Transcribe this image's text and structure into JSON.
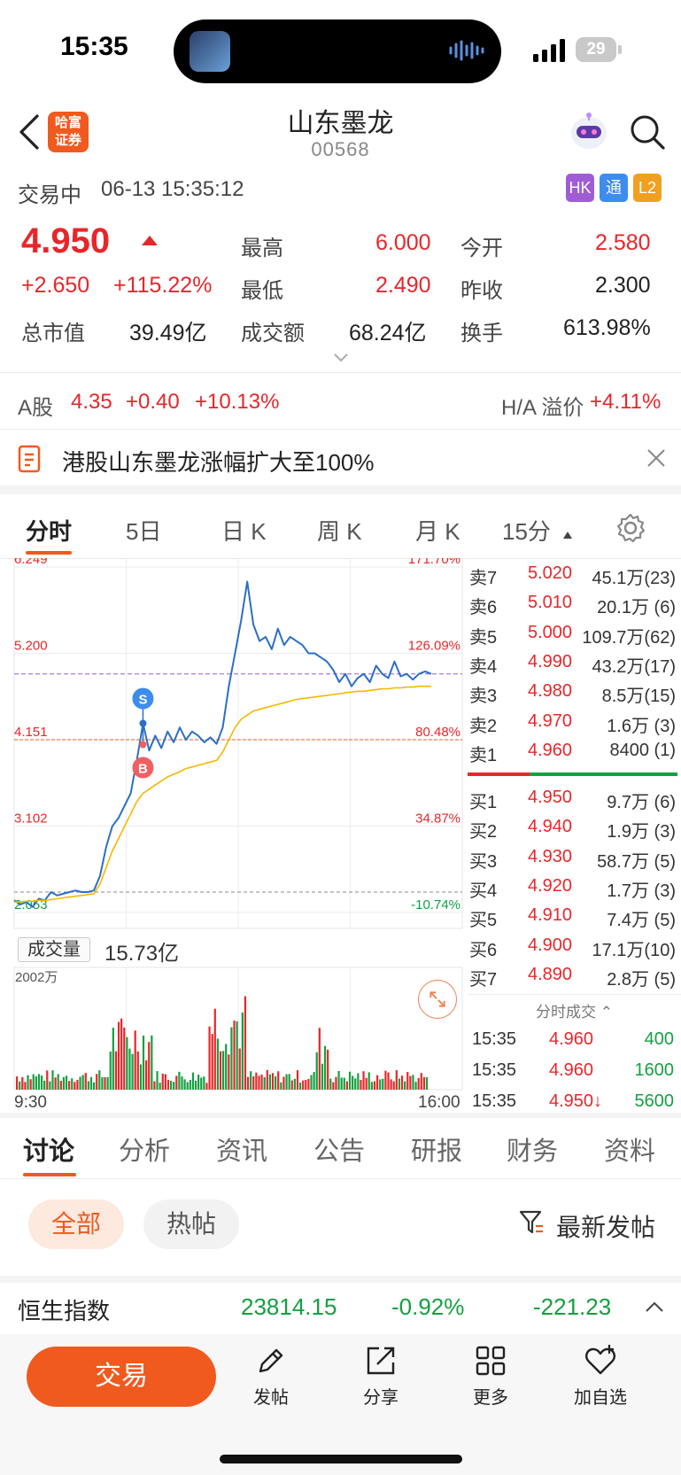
{
  "status_bar": {
    "time": "15:35",
    "battery": "29"
  },
  "header": {
    "logo_line1": "哈富",
    "logo_line2": "证券",
    "title": "山东墨龙",
    "code": "00568"
  },
  "trade_info": {
    "status": "交易中",
    "datetime": "06-13 15:35:12",
    "tags": [
      {
        "label": "HK",
        "color": "#a05cd6"
      },
      {
        "label": "通",
        "color": "#3d8cf0"
      },
      {
        "label": "L2",
        "color": "#f0a020"
      }
    ]
  },
  "quote": {
    "price": "4.950",
    "change": "+2.650",
    "change_pct": "+115.22%",
    "high_label": "最高",
    "high": "6.000",
    "low_label": "最低",
    "low": "2.490",
    "open_label": "今开",
    "open": "2.580",
    "prev_close_label": "昨收",
    "prev_close": "2.300",
    "mktcap_label": "总市值",
    "mktcap": "39.49亿",
    "turnover_label": "成交额",
    "turnover": "68.24亿",
    "turnover_rate_label": "换手",
    "turnover_rate": "613.98%"
  },
  "a_share": {
    "label": "A股",
    "price": "4.35",
    "change": "+0.40",
    "change_pct": "+10.13%",
    "premium_label": "H/A 溢价",
    "premium": "+4.11%"
  },
  "notice": {
    "text": "港股山东墨龙涨幅扩大至100%"
  },
  "chart_tabs": [
    "分时",
    "5日",
    "日 K",
    "周 K",
    "月 K",
    "15分"
  ],
  "chart_data": {
    "type": "line",
    "title": "",
    "x_start_label": "9:30",
    "x_end_label": "16:00",
    "price_axis": [
      "6.249",
      "5.200",
      "4.151",
      "3.102",
      "2.053"
    ],
    "pct_axis": [
      "171.70%",
      "126.09%",
      "80.48%",
      "34.87%",
      "-10.74%"
    ],
    "ylim": [
      2.053,
      6.249
    ],
    "prev_close": 2.3,
    "current_price": 4.95,
    "series": [
      {
        "color": "#2b6fc6",
        "values": [
          2.2,
          2.15,
          2.18,
          2.12,
          2.22,
          2.2,
          2.3,
          2.26,
          2.28,
          2.3,
          2.32,
          2.3,
          2.3,
          2.32,
          2.5,
          2.85,
          3.1,
          3.2,
          3.35,
          3.5,
          3.9,
          4.35,
          4.02,
          4.2,
          4.05,
          4.25,
          4.12,
          4.3,
          4.15,
          4.25,
          4.2,
          4.12,
          4.18,
          4.1,
          4.3,
          4.8,
          5.2,
          5.6,
          6.07,
          5.55,
          5.35,
          5.4,
          5.25,
          5.5,
          5.3,
          5.4,
          5.35,
          5.3,
          5.2,
          5.2,
          5.15,
          5.1,
          5.0,
          4.85,
          4.95,
          4.8,
          4.9,
          4.95,
          4.85,
          5.05,
          4.95,
          4.9,
          5.1,
          4.92,
          4.95,
          4.88,
          4.95,
          4.98,
          4.95
        ],
        "marks": [
          {
            "type": "S",
            "index": 21
          },
          {
            "type": "B",
            "index": 21
          }
        ]
      },
      {
        "color": "#f5b800",
        "values": [
          2.18,
          2.18,
          2.19,
          2.19,
          2.2,
          2.2,
          2.21,
          2.22,
          2.23,
          2.24,
          2.25,
          2.26,
          2.27,
          2.28,
          2.4,
          2.6,
          2.8,
          2.95,
          3.1,
          3.25,
          3.4,
          3.5,
          3.55,
          3.6,
          3.65,
          3.7,
          3.73,
          3.76,
          3.8,
          3.82,
          3.84,
          3.86,
          3.88,
          3.9,
          4.0,
          4.15,
          4.3,
          4.4,
          4.45,
          4.5,
          4.52,
          4.54,
          4.56,
          4.58,
          4.6,
          4.62,
          4.64,
          4.65,
          4.66,
          4.67,
          4.68,
          4.69,
          4.7,
          4.71,
          4.72,
          4.73,
          4.74,
          4.74,
          4.75,
          4.76,
          4.77,
          4.77,
          4.78,
          4.78,
          4.79,
          4.79,
          4.8,
          4.8,
          4.8
        ]
      }
    ],
    "volume_label": "成交量",
    "volume_total": "15.73亿",
    "volume_axis_top": "2002万"
  },
  "order_book": {
    "asks": [
      {
        "label": "卖7",
        "price": "5.020",
        "vol": "45.1万(23)"
      },
      {
        "label": "卖6",
        "price": "5.010",
        "vol": "20.1万 (6)"
      },
      {
        "label": "卖5",
        "price": "5.000",
        "vol": "109.7万(62)"
      },
      {
        "label": "卖4",
        "price": "4.990",
        "vol": "43.2万(17)"
      },
      {
        "label": "卖3",
        "price": "4.980",
        "vol": "8.5万(15)"
      },
      {
        "label": "卖2",
        "price": "4.970",
        "vol": "1.6万 (3)"
      },
      {
        "label": "卖1",
        "price": "4.960",
        "vol": "8400 (1)"
      }
    ],
    "bids": [
      {
        "label": "买1",
        "price": "4.950",
        "vol": "9.7万 (6)"
      },
      {
        "label": "买2",
        "price": "4.940",
        "vol": "1.9万 (3)"
      },
      {
        "label": "买3",
        "price": "4.930",
        "vol": "58.7万 (5)"
      },
      {
        "label": "买4",
        "price": "4.920",
        "vol": "1.7万 (3)"
      },
      {
        "label": "买5",
        "price": "4.910",
        "vol": "7.4万 (5)"
      },
      {
        "label": "买6",
        "price": "4.900",
        "vol": "17.1万(10)"
      },
      {
        "label": "买7",
        "price": "4.890",
        "vol": "2.8万 (5)"
      }
    ],
    "ticks_header": "分时成交 ⌃",
    "ticks": [
      {
        "time": "15:35",
        "price": "4.960",
        "vol": "400"
      },
      {
        "time": "15:35",
        "price": "4.960",
        "vol": "1600"
      },
      {
        "time": "15:35",
        "price": "4.950↓",
        "vol": "5600"
      }
    ]
  },
  "content_tabs": [
    "讨论",
    "分析",
    "资讯",
    "公告",
    "研报",
    "财务",
    "资料"
  ],
  "filters": {
    "all": "全部",
    "hot": "热帖",
    "sort": "最新发帖"
  },
  "index_bar": {
    "name": "恒生指数",
    "value": "23814.15",
    "pct": "-0.92%",
    "change": "-221.23"
  },
  "bottom_bar": {
    "trade": "交易",
    "post": "发帖",
    "share": "分享",
    "more": "更多",
    "watch": "加自选"
  }
}
